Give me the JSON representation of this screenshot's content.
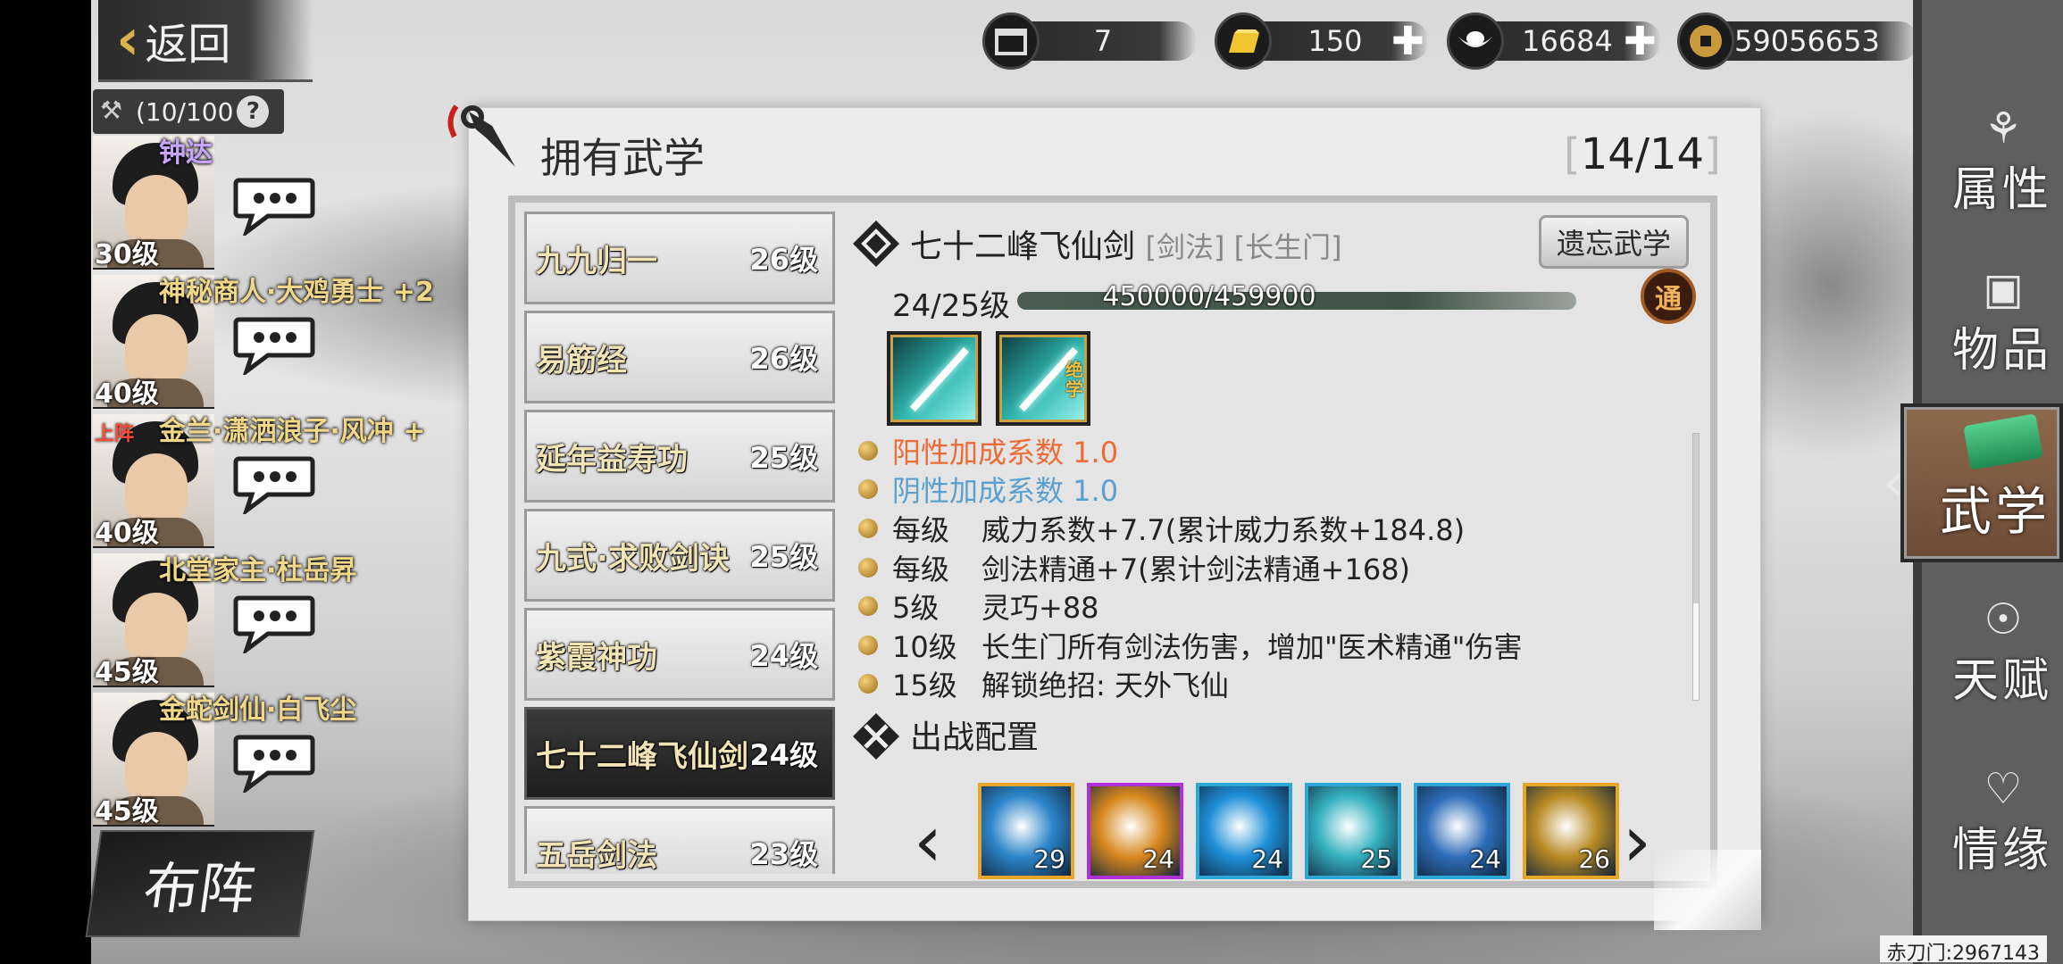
{
  "header": {
    "back_label": "返回",
    "party_count": "(10/100",
    "help": "?"
  },
  "currencies": [
    {
      "icon": "chest-icon",
      "value": "7"
    },
    {
      "icon": "gold-bar-icon",
      "value": "150"
    },
    {
      "icon": "silver-ingot-icon",
      "value": "16684"
    },
    {
      "icon": "copper-coin-icon",
      "value": "59056653"
    }
  ],
  "party": [
    {
      "name": "钟达",
      "level": "30级",
      "name_color": "purple",
      "on_stage": ""
    },
    {
      "name": "神秘商人·大鸡勇士 +2",
      "level": "40级",
      "name_color": "gold",
      "on_stage": ""
    },
    {
      "name": "金兰·潇洒浪子·风冲 +",
      "level": "40级",
      "name_color": "gold",
      "on_stage": "上阵"
    },
    {
      "name": "北堂家主·杜岳昇",
      "level": "45级",
      "name_color": "gold",
      "on_stage": ""
    },
    {
      "name": "金蛇剑仙·白飞尘",
      "level": "45级",
      "name_color": "gold",
      "on_stage": ""
    }
  ],
  "formation_label": "布阵",
  "right_nav": {
    "items": [
      "属性",
      "物品",
      "武学",
      "天赋",
      "情缘"
    ],
    "active_index": 2
  },
  "panel": {
    "title": "拥有武学",
    "count": "14/14",
    "skills": [
      {
        "name": "九九归一",
        "level": "26级"
      },
      {
        "name": "易筋经",
        "level": "26级"
      },
      {
        "name": "延年益寿功",
        "level": "25级"
      },
      {
        "name": "九式·求败剑诀",
        "level": "25级"
      },
      {
        "name": "紫霞神功",
        "level": "24级"
      },
      {
        "name": "七十二峰飞仙剑",
        "level": "24级"
      },
      {
        "name": "五岳剑法",
        "level": "23级"
      }
    ],
    "selected_index": 5
  },
  "detail": {
    "name": "七十二峰飞仙剑",
    "tags": "[剑法] [长生门]",
    "forget_button": "遗忘武学",
    "level": "24/25级",
    "exp": "450000/459900",
    "exp_fraction": 0.978,
    "tong": "通",
    "skill_tile_badge": "绝学",
    "attributes": [
      {
        "k": "阳性加成系数 1.0",
        "v": "",
        "style": "yang"
      },
      {
        "k": "阴性加成系数 1.0",
        "v": "",
        "style": "yin"
      },
      {
        "k": "每级",
        "v": "威力系数+7.7(累计威力系数+184.8)",
        "style": ""
      },
      {
        "k": "每级",
        "v": "剑法精通+7(累计剑法精通+168)",
        "style": ""
      },
      {
        "k": "5级",
        "v": "灵巧+88",
        "style": ""
      },
      {
        "k": "10级",
        "v": "长生门所有剑法伤害，增加\"医术精通\"伤害",
        "style": ""
      },
      {
        "k": "15级",
        "v": "解锁绝招: 天外飞仙",
        "style": ""
      }
    ],
    "sortie_title": "出战配置",
    "equipped": [
      {
        "level": "29",
        "border": "#e8a628",
        "bg": "#2b85c9"
      },
      {
        "level": "24",
        "border": "#b12fd6",
        "bg": "#d7881e"
      },
      {
        "level": "24",
        "border": "#2da6d8",
        "bg": "#1e8fd7"
      },
      {
        "level": "25",
        "border": "#2da6d8",
        "bg": "#34b1c0"
      },
      {
        "level": "24",
        "border": "#2da6d8",
        "bg": "#2d6db8"
      },
      {
        "level": "26",
        "border": "#e8a628",
        "bg": "#b88a24"
      }
    ]
  },
  "guild": "赤刀门:2967143"
}
